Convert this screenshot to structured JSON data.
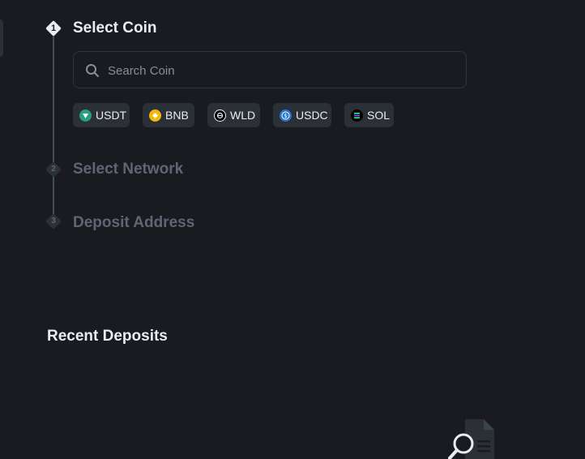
{
  "steps": [
    {
      "number": "1",
      "title": "Select Coin"
    },
    {
      "number": "2",
      "title": "Select Network"
    },
    {
      "number": "3",
      "title": "Deposit Address"
    }
  ],
  "search": {
    "placeholder": "Search Coin",
    "value": ""
  },
  "coins": [
    {
      "label": "USDT",
      "icon": "usdt-icon",
      "color": "#26a17b"
    },
    {
      "label": "BNB",
      "icon": "bnb-icon",
      "color": "#f0b90b"
    },
    {
      "label": "WLD",
      "icon": "wld-icon",
      "color": "#000000"
    },
    {
      "label": "USDC",
      "icon": "usdc-icon",
      "color": "#2775ca"
    },
    {
      "label": "SOL",
      "icon": "sol-icon",
      "color": "#9945ff"
    }
  ],
  "recent_deposits": {
    "title": "Recent Deposits"
  }
}
